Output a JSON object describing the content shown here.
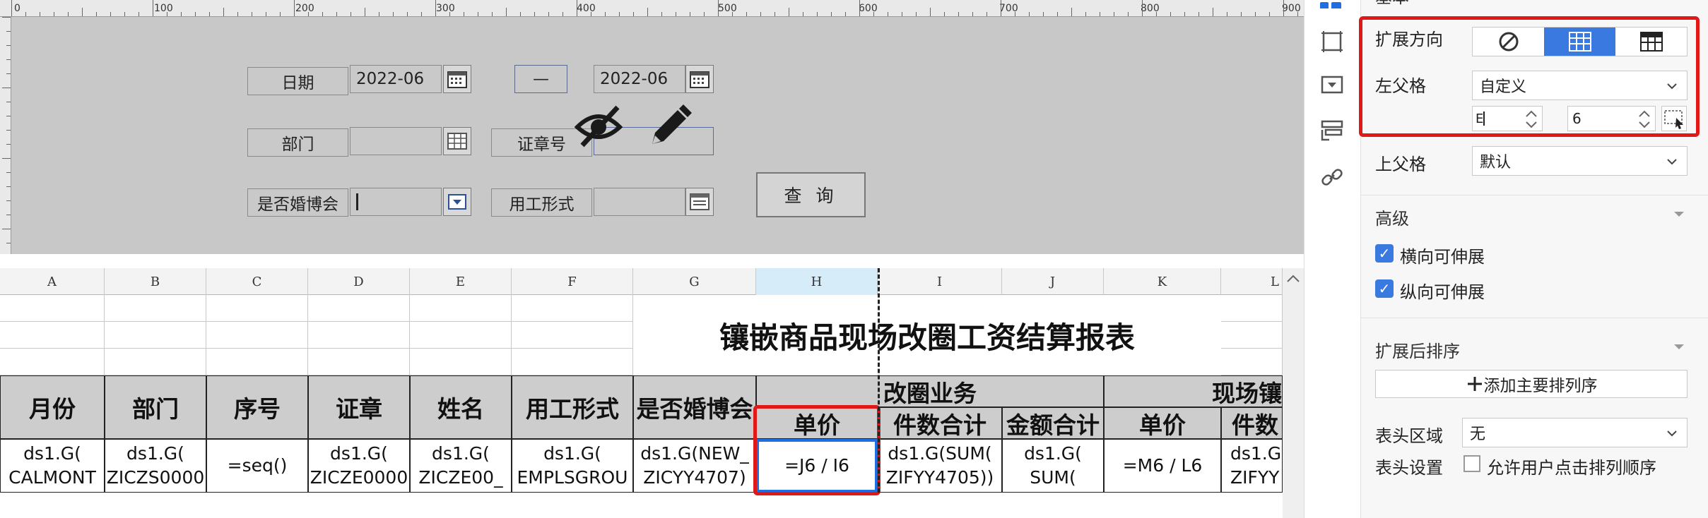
{
  "ruler": {
    "labels": [
      "0",
      "100",
      "200",
      "300",
      "400",
      "500",
      "600",
      "700",
      "800",
      "900"
    ]
  },
  "form": {
    "date_label": "日期",
    "date_from": "2022-06",
    "range_sep": "—",
    "date_to": "2022-06",
    "dept_label": "部门",
    "cert_label": "证章号",
    "marriage_label": "是否婚博会",
    "employ_label": "用工形式",
    "query_button": "查 询"
  },
  "sheet": {
    "columns": [
      "A",
      "B",
      "C",
      "D",
      "E",
      "F",
      "G",
      "H",
      "I",
      "J",
      "K",
      "L"
    ],
    "title": "镶嵌商品现场改圈工资结算报表",
    "headers": [
      "月份",
      "部门",
      "序号",
      "证章",
      "姓名",
      "用工形式",
      "是否婚博会"
    ],
    "group1": "改圈业务",
    "group1_cols": [
      "单价",
      "件数合计",
      "金额合计"
    ],
    "group2": "现场镶",
    "group2_cols": [
      "单价",
      "件数"
    ],
    "row": [
      "ds1.G(\nCALMONT",
      "ds1.G(\nZICZS0000",
      "=seq()",
      "ds1.G(\nZICZE0000",
      "ds1.G(\nZICZE00_",
      "ds1.G(\nEMPLSGROU",
      "ds1.G(NEW_\nZICYY4707)",
      "=J6 / I6",
      "ds1.G(SUM(\nZIFYY4705))",
      "ds1.G(\nSUM(",
      "=M6 / L6",
      "ds1.G\nZIFYY"
    ]
  },
  "panel": {
    "top_fragment": "基本",
    "expand_dir_label": "扩展方向",
    "left_parent_label": "左父格",
    "left_parent_value": "自定义",
    "left_parent_col": "E",
    "left_parent_row": "6",
    "upper_parent_label": "上父格",
    "upper_parent_value": "默认",
    "advanced_label": "高级",
    "h_stretch": "横向可伸展",
    "v_stretch": "纵向可伸展",
    "sort_label": "扩展后排序",
    "add_sort_button": "添加主要排列序",
    "header_area_label": "表头区域",
    "header_area_value": "无",
    "header_settings_label": "表头设置",
    "allow_sort_label": "允许用户点击排列顺序"
  },
  "colors": {
    "accent": "#3a7ae0",
    "highlight": "#e01818",
    "selected": "#1f6fe0"
  }
}
